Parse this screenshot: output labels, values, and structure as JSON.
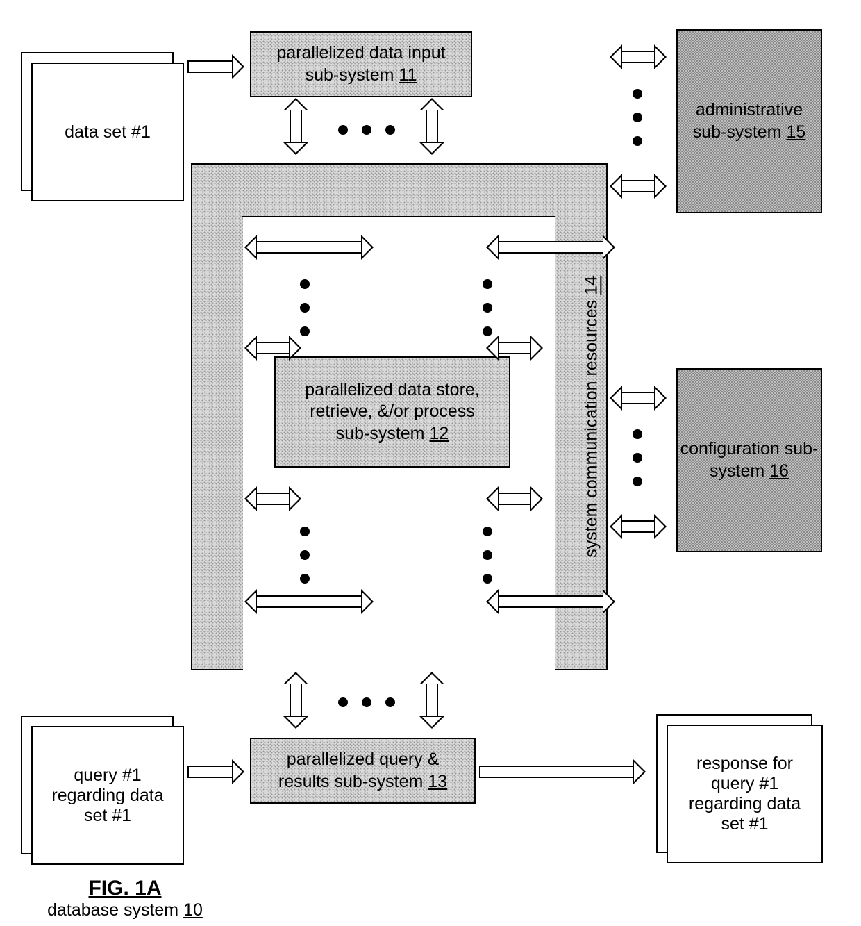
{
  "dataset_label": "data set #1",
  "query_label": "query #1 regarding data set #1",
  "response_label": "response for query #1 regarding data set #1",
  "input_box": {
    "line1": "parallelized data input",
    "line2_a": "sub-system ",
    "line2_u": "11"
  },
  "store_box": {
    "line1": "parallelized data store,",
    "line2": "retrieve, &/or process",
    "line3_a": "sub-system ",
    "line3_u": "12"
  },
  "query_box": {
    "line1": "parallelized query &",
    "line2_a": "results sub-system ",
    "line2_u": "13"
  },
  "comm_box": {
    "line1_a": "system communication resources ",
    "line1_u": "14"
  },
  "admin_box": {
    "line1": "administrative",
    "line2_a": "sub-system ",
    "line2_u": "15"
  },
  "config_box": {
    "line1": "configuration sub-",
    "line2_a": "system ",
    "line2_u": "16"
  },
  "caption": {
    "fig": "FIG. 1A",
    "title_a": "database system ",
    "title_u": "10"
  }
}
